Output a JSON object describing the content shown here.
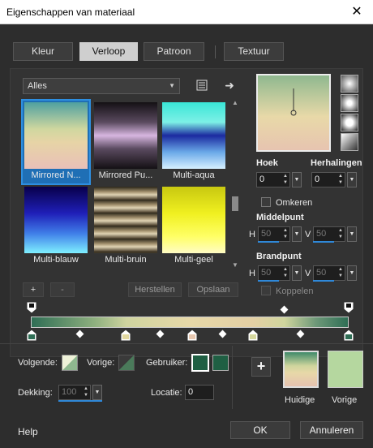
{
  "window": {
    "title": "Eigenschappen van materiaal",
    "close_glyph": "✕"
  },
  "tabs": [
    {
      "label": "Kleur",
      "active": false
    },
    {
      "label": "Verloop",
      "active": true
    },
    {
      "label": "Patroon",
      "active": false
    },
    {
      "label": "Textuur",
      "active": false
    }
  ],
  "library": {
    "category": "Alles",
    "items": [
      {
        "label": "Mirrored N...",
        "selected": true
      },
      {
        "label": "Mirrored Pu...",
        "selected": false
      },
      {
        "label": "Multi-aqua",
        "selected": false
      },
      {
        "label": "Multi-blauw",
        "selected": false
      },
      {
        "label": "Multi-bruin",
        "selected": false
      },
      {
        "label": "Multi-geel",
        "selected": false
      }
    ],
    "add_label": "+",
    "remove_label": "-",
    "restore_label": "Herstellen",
    "save_label": "Opslaan"
  },
  "properties": {
    "angle_label": "Hoek",
    "angle_value": "0",
    "repeats_label": "Herhalingen",
    "repeats_value": "0",
    "invert_label": "Omkeren",
    "center_label": "Middelpunt",
    "center_h_label": "H",
    "center_h": "50",
    "center_v_label": "V",
    "center_v": "50",
    "focus_label": "Brandpunt",
    "focus_h_label": "H",
    "focus_h": "50",
    "focus_v_label": "V",
    "focus_v": "50",
    "link_label": "Koppelen"
  },
  "editor": {
    "following_label": "Volgende:",
    "previous_label": "Vorige:",
    "user_label": "Gebruiker:",
    "user_color": "#1f5f43",
    "opacity_label": "Dekking:",
    "opacity_value": "100",
    "location_label": "Locatie:",
    "location_value": "0"
  },
  "compare": {
    "add_glyph": "+",
    "current_label": "Huidige",
    "previous_label": "Vorige",
    "previous_color": "#b5d79f"
  },
  "footer": {
    "help_label": "Help",
    "ok_label": "OK",
    "cancel_label": "Annuleren"
  },
  "colors": {
    "accent": "#2e8fe0",
    "dialog_bg": "#2d2d2d",
    "gradient_dark": "#2f6e55",
    "gradient_light": "#e8d9a8"
  }
}
